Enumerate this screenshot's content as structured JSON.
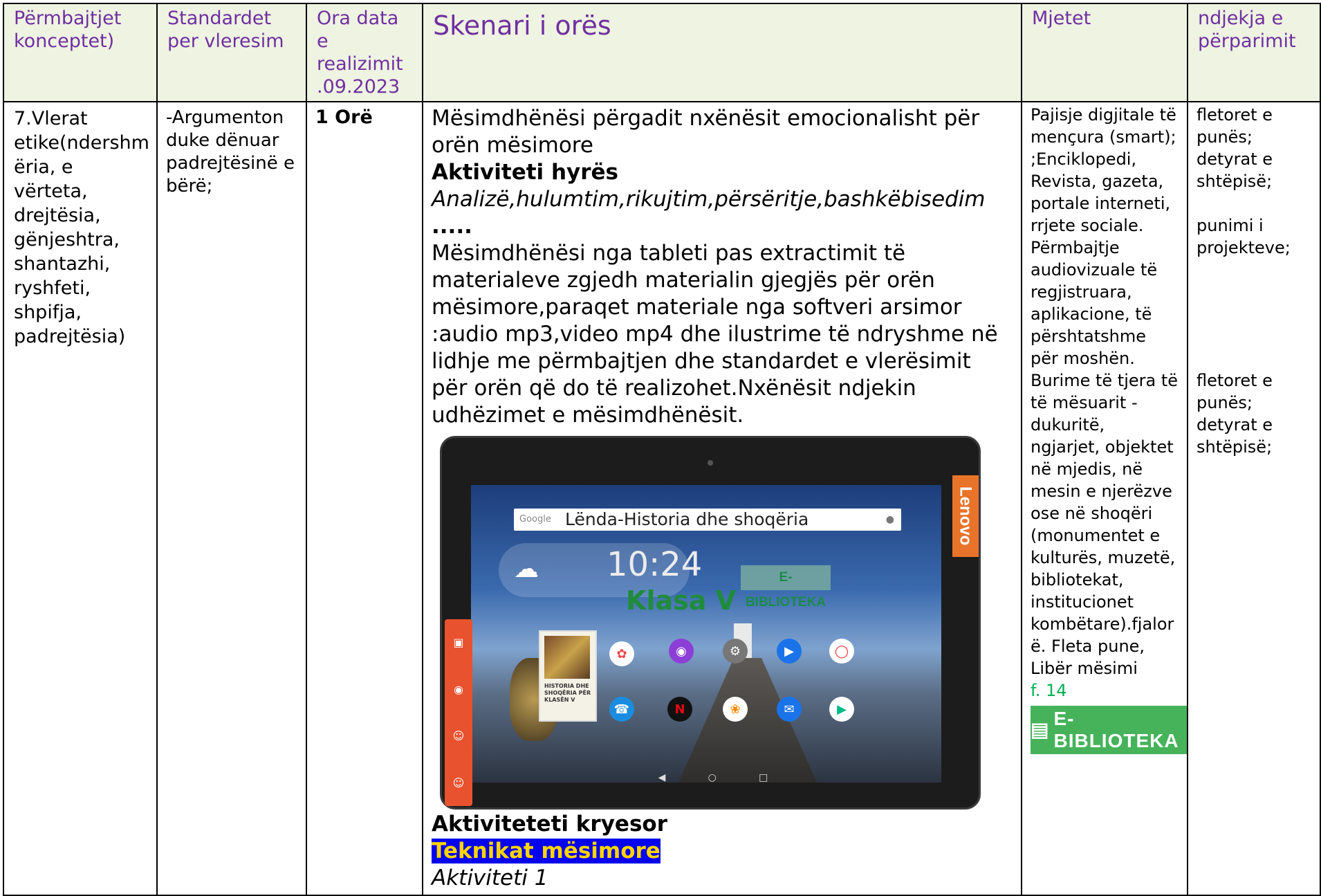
{
  "header": {
    "col1": "Përmbajtjet konceptet)",
    "col2": "Standardet per vleresim",
    "col3": "Ora data e realizimit .09.2023",
    "col4": "Skenari i orës",
    "col5": "Mjetet",
    "col6": "ndjekja e përparimit"
  },
  "row": {
    "concepts": "7.Vlerat etike(ndershm ëria, e vërteta, drejtësia, gënjeshtra, shantazhi, ryshfeti, shpifja, padrejtësia)",
    "standard": "-Argumenton duke dënuar padrejtësinë e bërë;",
    "hours": "1 Orë",
    "scenario": {
      "intro": "Mësimdhënësi përgadit nxënësit emocionalisht për orën mësimore",
      "activity_heading": "Aktiviteti hyrës",
      "methods": "Analizë,hulumtim,rikujtim,përsëritje,bashkëbisedim",
      "methods_suffix": " .....",
      "body": "Mësimdhënësi nga tableti pas extractimit të materialeve zgjedh materialin gjegjës për orën mësimore,paraqet materiale nga softveri arsimor :audio mp3,video mp4 dhe ilustrime të ndryshme në lidhje me përmbajtjen dhe standardet e vlerësimit për orën që do të realizohet.Nxënësit ndjekin udhëzimet e mësimdhënësit.",
      "main_heading": "Aktiviteteti kryesor",
      "techniques": "Teknikat mësimore",
      "activity1": "Aktiviteti 1"
    },
    "tools": "Pajisje digjitale të mençura (smart); ;Enciklopedi, Revista, gazeta, portale interneti, rrjete sociale. Përmbajtje audiovizuale të regjistruara, aplikacione, të përshtatshme për moshën. Burime të tjera të të mësuarit - dukuritë, ngjarjet, objektet në mjedis, në mesin e njerëzve ose në shoqëri (monumentet e kulturës, muzetë, bibliotekat, institucionet kombëtare).fjalor ë. Fleta pune, Libër mësimi",
    "tools_page": "f. 14",
    "tools_badge": "E-BIBLIOTEKA",
    "progress": {
      "a1": "fletoret e punës;",
      "a2": "detyrat e shtëpisë;",
      "b1": "punimi i projekteve;",
      "c1": "fletoret e punës;",
      "c2": "detyrat e shtëpisë;"
    }
  },
  "tablet": {
    "brand": "Lenovo",
    "search_text": "Lënda-Historia dhe shoqëria",
    "search_logo": "Google",
    "clock": "10:24",
    "badge": "E-BIBLIOTEKA",
    "class_label": "Klasa V",
    "book_title": "HISTORIA DHE SHOQËRIA PËR KLASËN V"
  }
}
